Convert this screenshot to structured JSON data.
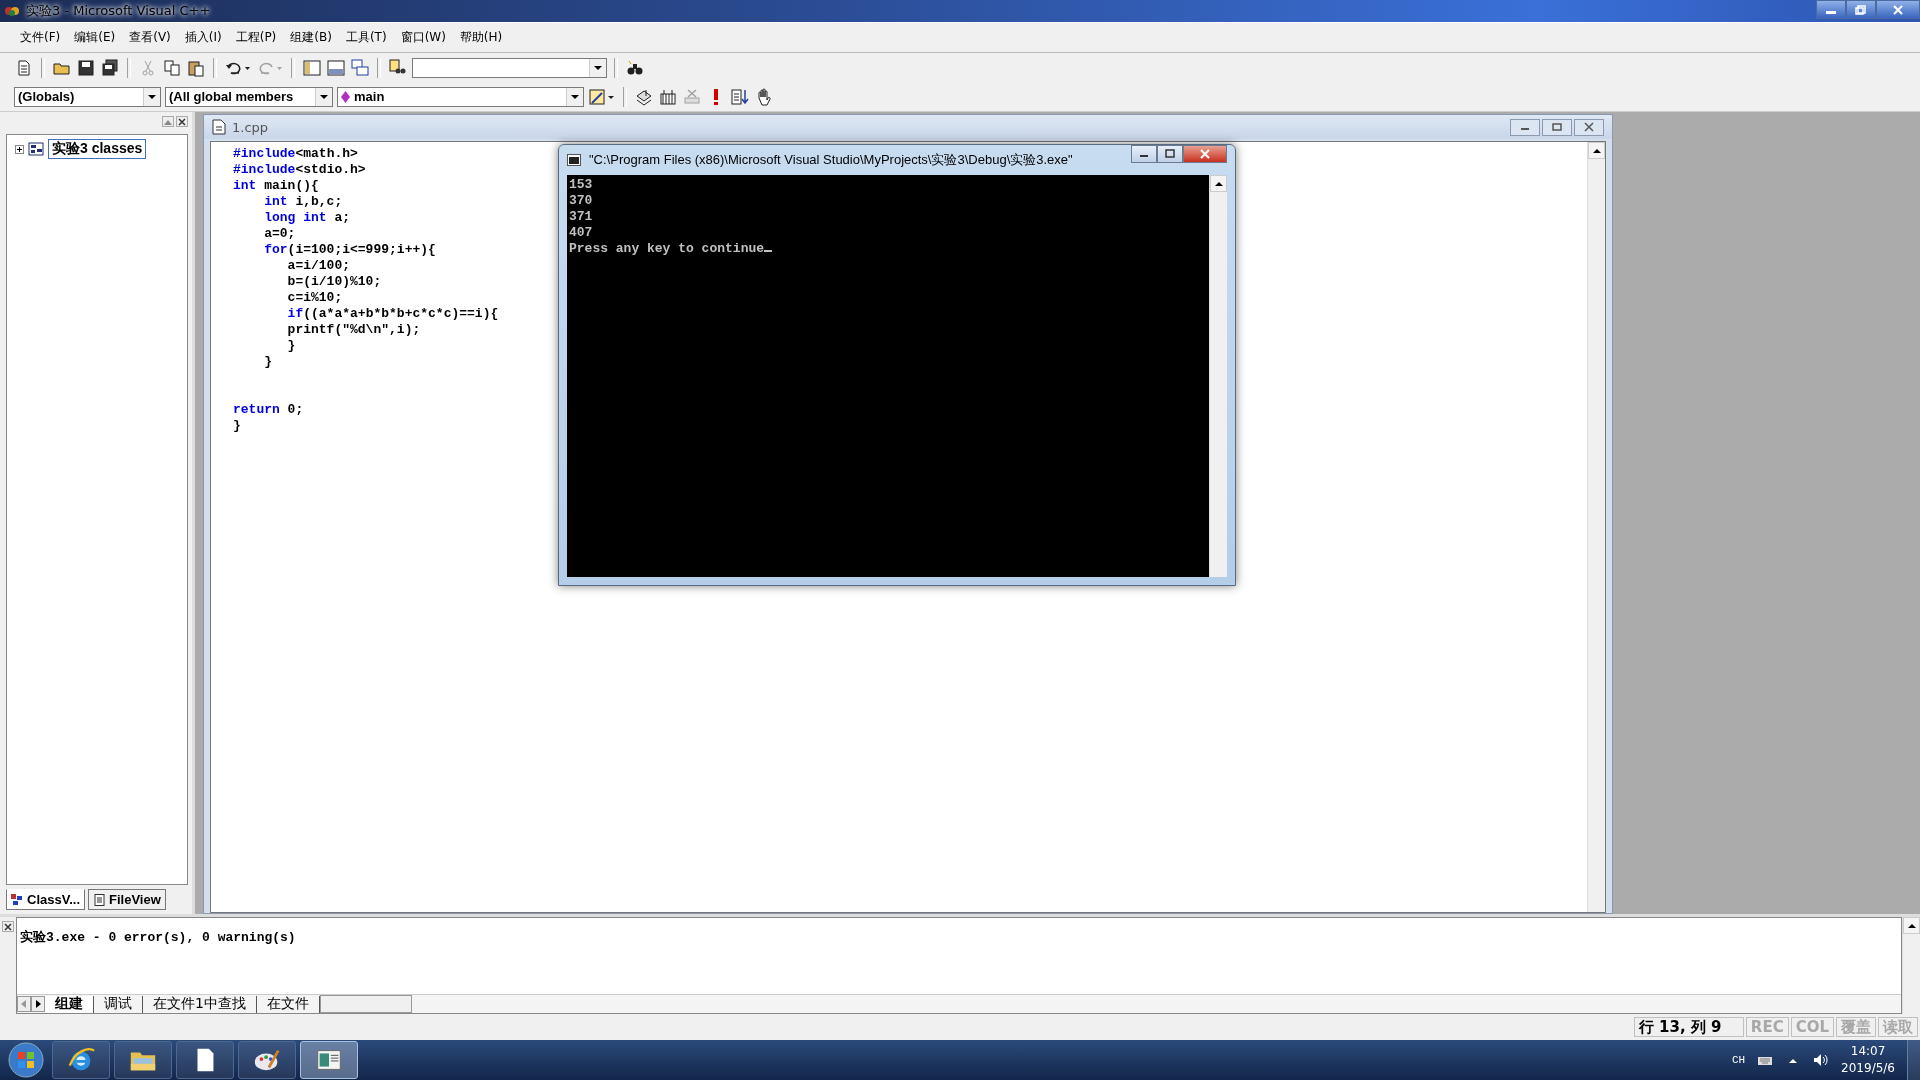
{
  "window": {
    "title": "实验3 - Microsoft Visual C++"
  },
  "menu": [
    "文件(F)",
    "编辑(E)",
    "查看(V)",
    "插入(I)",
    "工程(P)",
    "组建(B)",
    "工具(T)",
    "窗口(W)",
    "帮助(H)"
  ],
  "toolbar_1": [
    {
      "kind": "new",
      "disabled": false
    },
    {
      "kind": "separator"
    },
    {
      "kind": "open",
      "disabled": false
    },
    {
      "kind": "save",
      "disabled": false
    },
    {
      "kind": "save_all",
      "disabled": false
    },
    {
      "kind": "separator"
    },
    {
      "kind": "cut",
      "disabled": true
    },
    {
      "kind": "copy",
      "disabled": false
    },
    {
      "kind": "paste",
      "disabled": false
    },
    {
      "kind": "separator"
    },
    {
      "kind": "undo",
      "disabled": false
    },
    {
      "kind": "redo",
      "disabled": true
    },
    {
      "kind": "separator"
    },
    {
      "kind": "workspace",
      "disabled": false
    },
    {
      "kind": "output",
      "disabled": false
    },
    {
      "kind": "windows",
      "disabled": false
    },
    {
      "kind": "separator"
    },
    {
      "kind": "find_in_files",
      "disabled": false
    },
    {
      "kind": "combo"
    },
    {
      "kind": "separator"
    },
    {
      "kind": "find",
      "disabled": false
    }
  ],
  "toolbar_2": [
    {
      "kind": "combo",
      "value": "(Globals)"
    },
    {
      "kind": "combo",
      "value": "(All global members"
    },
    {
      "kind": "combo",
      "value": "main",
      "icon": true
    },
    {
      "kind": "wizard",
      "disabled": false
    },
    {
      "kind": "separator"
    },
    {
      "kind": "compile",
      "disabled": false
    },
    {
      "kind": "build",
      "disabled": false
    },
    {
      "kind": "stop",
      "disabled": true
    },
    {
      "kind": "execute",
      "disabled": false
    },
    {
      "kind": "go",
      "disabled": false
    },
    {
      "kind": "breakpoint",
      "disabled": false
    }
  ],
  "workspace": {
    "tree": [
      {
        "label": "实验3 classes",
        "expanded": false,
        "selected": true
      }
    ],
    "tabs": [
      {
        "label": "ClassV...",
        "selected": true
      },
      {
        "label": "FileView",
        "selected": false
      }
    ]
  },
  "editor": {
    "title": "1.cpp",
    "lines": [
      {
        "kind": "code",
        "segments": [
          {
            "text": "#include",
            "kind": "keyword"
          },
          {
            "text": "<math.h>",
            "kind": "plain"
          }
        ]
      },
      {
        "kind": "code",
        "segments": [
          {
            "text": "#include",
            "kind": "keyword"
          },
          {
            "text": "<stdio.h>",
            "kind": "plain"
          }
        ]
      },
      {
        "kind": "code",
        "segments": [
          {
            "text": "int",
            "kind": "keyword"
          },
          {
            "text": " main(){",
            "kind": "plain"
          }
        ]
      },
      {
        "kind": "code",
        "segments": [
          {
            "text": "    int",
            "kind": "keyword"
          },
          {
            "text": " i,b,c;",
            "kind": "plain"
          }
        ]
      },
      {
        "kind": "code",
        "segments": [
          {
            "text": "    long int",
            "kind": "keyword"
          },
          {
            "text": " a;",
            "kind": "plain"
          }
        ]
      },
      {
        "kind": "code",
        "segments": [
          {
            "text": "    a=0;",
            "kind": "plain"
          }
        ]
      },
      {
        "kind": "code",
        "segments": [
          {
            "text": "    for",
            "kind": "keyword"
          },
          {
            "text": "(i=100;i<=999;i++){",
            "kind": "plain"
          }
        ]
      },
      {
        "kind": "code",
        "segments": [
          {
            "text": "       a=i/100;",
            "kind": "plain"
          }
        ]
      },
      {
        "kind": "code",
        "segments": [
          {
            "text": "       b=(i/10)%10;",
            "kind": "plain"
          }
        ]
      },
      {
        "kind": "code",
        "segments": [
          {
            "text": "       c=i%10;",
            "kind": "plain"
          }
        ]
      },
      {
        "kind": "code",
        "segments": [
          {
            "text": "       if",
            "kind": "keyword"
          },
          {
            "text": "((a*a*a+b*b*b+c*c*c)==i){",
            "kind": "plain"
          }
        ]
      },
      {
        "kind": "code",
        "segments": [
          {
            "text": "       printf(\"%d\\n\",i);",
            "kind": "plain"
          }
        ]
      },
      {
        "kind": "code",
        "segments": [
          {
            "text": "       }",
            "kind": "plain"
          }
        ]
      },
      {
        "kind": "code",
        "segments": [
          {
            "text": "    }",
            "kind": "plain"
          }
        ]
      },
      {
        "kind": "blank"
      },
      {
        "kind": "blank"
      },
      {
        "kind": "code",
        "segments": [
          {
            "text": "return",
            "kind": "keyword"
          },
          {
            "text": " 0;",
            "kind": "plain"
          }
        ]
      },
      {
        "kind": "code",
        "segments": [
          {
            "text": "}",
            "kind": "plain"
          }
        ]
      }
    ]
  },
  "console": {
    "title": "\"C:\\Program Files (x86)\\Microsoft Visual Studio\\MyProjects\\实验3\\Debug\\实验3.exe\"",
    "lines": [
      "153",
      "370",
      "371",
      "407",
      "Press any key to continue"
    ]
  },
  "output": {
    "text": "实验3.exe - 0 error(s), 0 warning(s)",
    "tabs": [
      {
        "label": "组建",
        "selected": true
      },
      {
        "label": "调试",
        "selected": false
      },
      {
        "label": "在文件1中查找",
        "selected": false
      },
      {
        "label": "在文件",
        "selected": false
      }
    ]
  },
  "status_bar": [
    {
      "text": "行 13, 列 9",
      "disabled": false
    },
    {
      "text": "REC",
      "disabled": true
    },
    {
      "text": "COL",
      "disabled": true
    },
    {
      "text": "覆盖",
      "disabled": true
    },
    {
      "text": "读取",
      "disabled": true
    }
  ],
  "taskbar": {
    "apps": [
      {
        "kind": "browser",
        "selected": false
      },
      {
        "kind": "folder",
        "selected": false
      },
      {
        "kind": "document",
        "selected": false
      },
      {
        "kind": "paint",
        "selected": false
      },
      {
        "kind": "ide",
        "selected": true
      }
    ],
    "language": "CH",
    "time": "14:07",
    "date": "2019/5/6"
  }
}
